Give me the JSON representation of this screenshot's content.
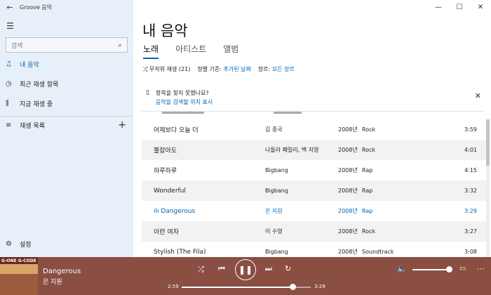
{
  "window": {
    "title": "Groove 음악",
    "back": "←",
    "minimize": "—",
    "maximize": "☐",
    "close": "✕"
  },
  "sidebar": {
    "search_placeholder": "검색",
    "items": [
      {
        "label": "내 음악",
        "icon": "music-note-icon",
        "glyph": "♫"
      },
      {
        "label": "최근 재생 항목",
        "icon": "clock-icon",
        "glyph": "◷"
      },
      {
        "label": "지금 재생 중",
        "icon": "bars-icon",
        "glyph": "⫼"
      },
      {
        "label": "재생 목록",
        "icon": "playlist-icon",
        "glyph": "≡"
      }
    ],
    "settings": "설정"
  },
  "main": {
    "title": "내 음악",
    "tabs": [
      "노래",
      "아티스트",
      "앨범"
    ],
    "active_tab": 0,
    "shuffle": "무작위 재생 (21)",
    "sort_label": "정렬 기준:",
    "sort_value": "추가된 날짜",
    "genre_label": "장르:",
    "genre_value": "모든 장르",
    "notice_line1": "항목을 찾지 못했나요?",
    "notice_line2": "음악을 검색할 위치 표시"
  },
  "songs": [
    {
      "title": "어제보다 오늘 더",
      "artist": "김 종국",
      "year": "2008년",
      "genre": "Rock",
      "duration": "3:59"
    },
    {
      "title": "불잡아도",
      "artist": "나돌라 패밀리, 백 지영",
      "year": "2008년",
      "genre": "Rock",
      "duration": "4:01"
    },
    {
      "title": "하루하루",
      "artist": "Bigbang",
      "year": "2008년",
      "genre": "Rap",
      "duration": "4:15"
    },
    {
      "title": "Wonderful",
      "artist": "Bigbang",
      "year": "2008년",
      "genre": "Rap",
      "duration": "3:32"
    },
    {
      "title": "Dangerous",
      "artist": "은 지원",
      "year": "2008년",
      "genre": "Rap",
      "duration": "3:29"
    },
    {
      "title": "이런 여자",
      "artist": "이 수영",
      "year": "2008년",
      "genre": "Rock",
      "duration": "3:27"
    },
    {
      "title": "Stylish (The Fila)",
      "artist": "Bigbang",
      "year": "2008년",
      "genre": "Soundtrack",
      "duration": "3:08"
    }
  ],
  "playing_index": 4,
  "player": {
    "title": "Dangerous",
    "artist": "은 지원",
    "current_time": "2:59",
    "total_time": "3:29",
    "progress": 0.86,
    "volume": 1.0,
    "album_text": "G-ONE G-CODE"
  },
  "colors": {
    "accent": "#0063b1",
    "sidebar_bg": "#e7f0f8",
    "player_bg": "#8a4e42"
  }
}
